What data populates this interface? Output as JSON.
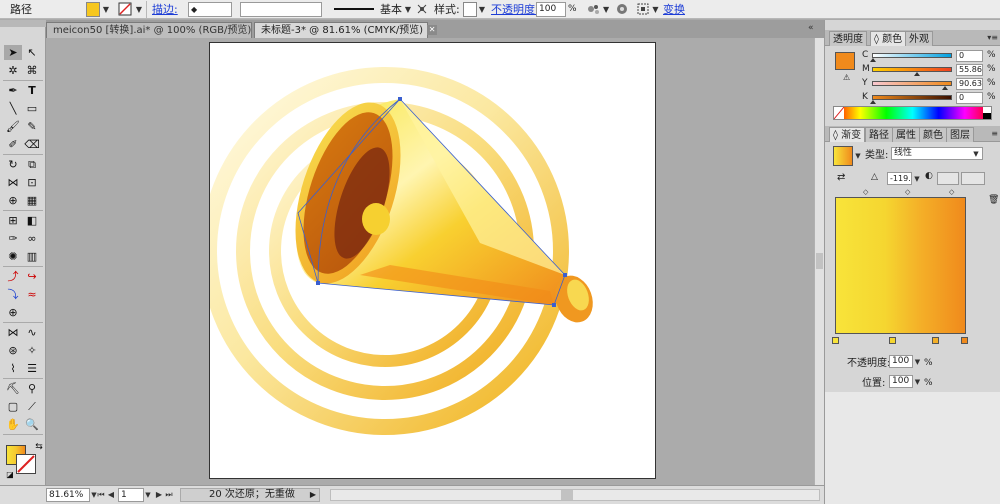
{
  "control_bar": {
    "object_type": "路径",
    "fill_color": "#f6c71f",
    "stroke_label": "描边:",
    "stroke_profile": "基本",
    "style_label": "样式:",
    "opacity_label": "不透明度:",
    "opacity_value": "100",
    "opacity_unit": "%",
    "transform_label": "变换"
  },
  "tabs": [
    {
      "label": "meicon50 [转换].ai* @ 100% (RGB/预览)"
    },
    {
      "label": "未标题-3* @ 81.61% (CMYK/预览)"
    }
  ],
  "status_bar": {
    "zoom": "81.61%",
    "page": "1",
    "undo_info": "20 次还原；无重做"
  },
  "color_panel": {
    "tabs": [
      "透明度",
      "颜色",
      "外观"
    ],
    "active_tab": "颜色",
    "swatch": "#f08a1c",
    "sliders": [
      {
        "name": "C",
        "value": "0",
        "unit": "%"
      },
      {
        "name": "M",
        "value": "55.86",
        "unit": "%"
      },
      {
        "name": "Y",
        "value": "90.63",
        "unit": "%"
      },
      {
        "name": "K",
        "value": "0",
        "unit": "%"
      }
    ]
  },
  "gradient_panel": {
    "tabs": [
      "渐变",
      "路径",
      "属性",
      "颜色",
      "图层"
    ],
    "active_tab": "渐变",
    "type_label": "类型:",
    "type_value": "线性",
    "angle_value": "-119.",
    "opacity_label": "不透明度:",
    "opacity_value": "100",
    "position_label": "位置:",
    "position_value": "100",
    "unit": "%",
    "colors": [
      "#f8e43a",
      "#f5d630",
      "#f4b028",
      "#f08a1c"
    ]
  }
}
